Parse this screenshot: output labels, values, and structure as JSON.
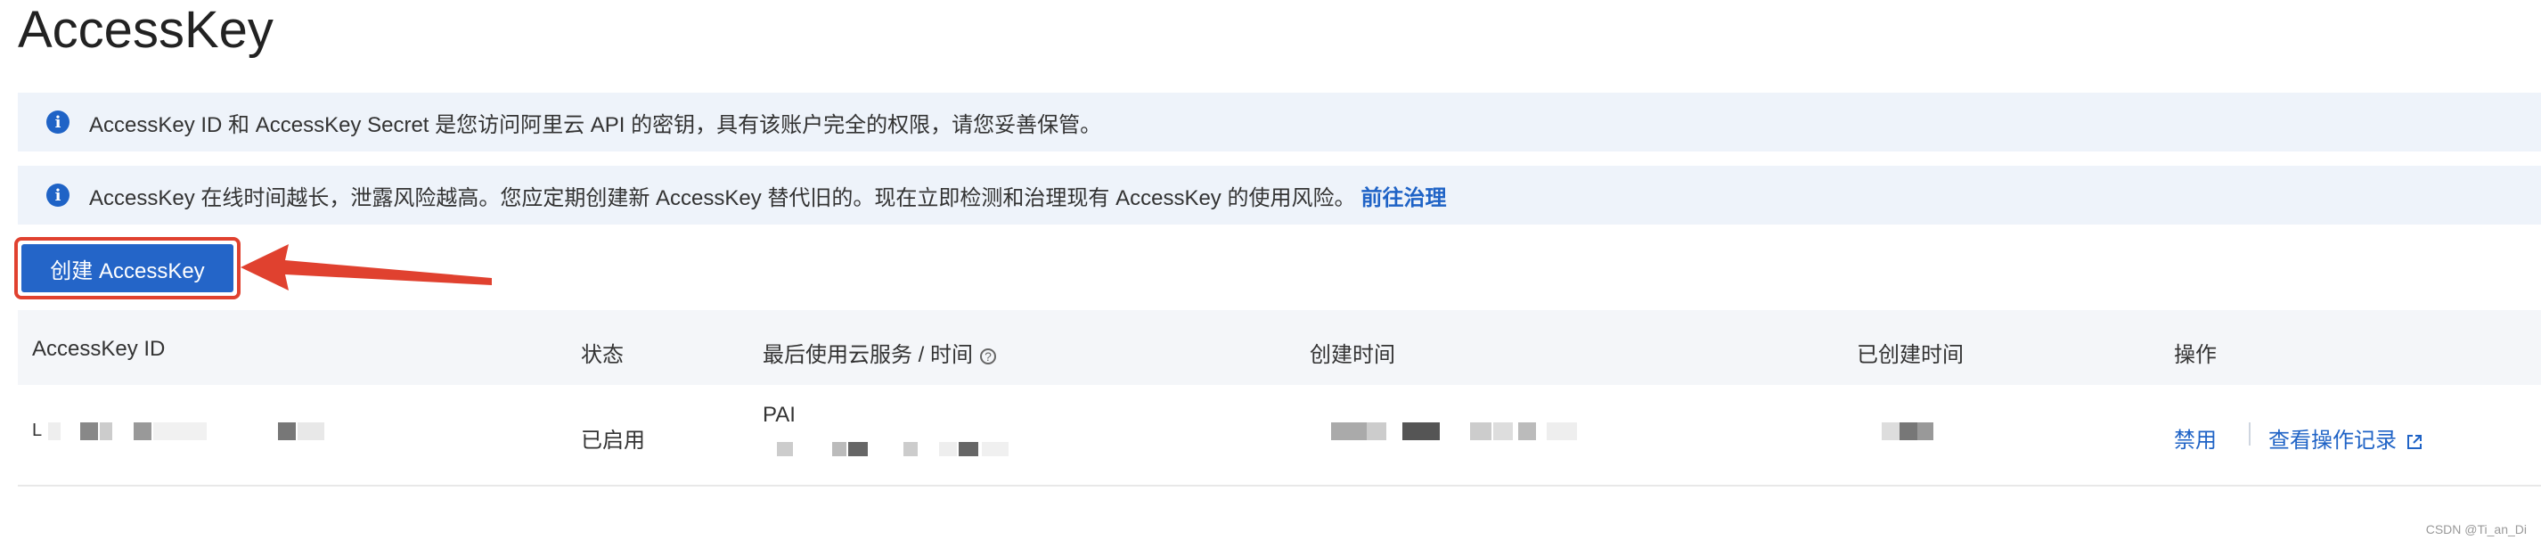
{
  "page": {
    "title": "AccessKey"
  },
  "notices": [
    {
      "text": "AccessKey ID 和 AccessKey Secret 是您访问阿里云 API 的密钥，具有该账户完全的权限，请您妥善保管。",
      "link": ""
    },
    {
      "text": "AccessKey 在线时间越长，泄露风险越高。您应定期创建新 AccessKey 替代旧的。现在立即检测和治理现有 AccessKey 的使用风险。",
      "link": "前往治理"
    }
  ],
  "toolbar": {
    "create_label": "创建 AccessKey"
  },
  "table": {
    "headers": {
      "access_key_id": "AccessKey ID",
      "status": "状态",
      "last_used": "最后使用云服务 / 时间",
      "created_time": "创建时间",
      "created_since": "已创建时间",
      "actions": "操作"
    },
    "rows": [
      {
        "access_key_id_prefix": "L",
        "status": "已启用",
        "service": "PAI",
        "actions": {
          "disable": "禁用",
          "view_log": "查看操作记录"
        }
      }
    ]
  },
  "watermark": "CSDN @Ti_an_Di",
  "colors": {
    "accent": "#2465c8",
    "highlight": "#e0412f",
    "notice_bg": "#eef3fa"
  }
}
